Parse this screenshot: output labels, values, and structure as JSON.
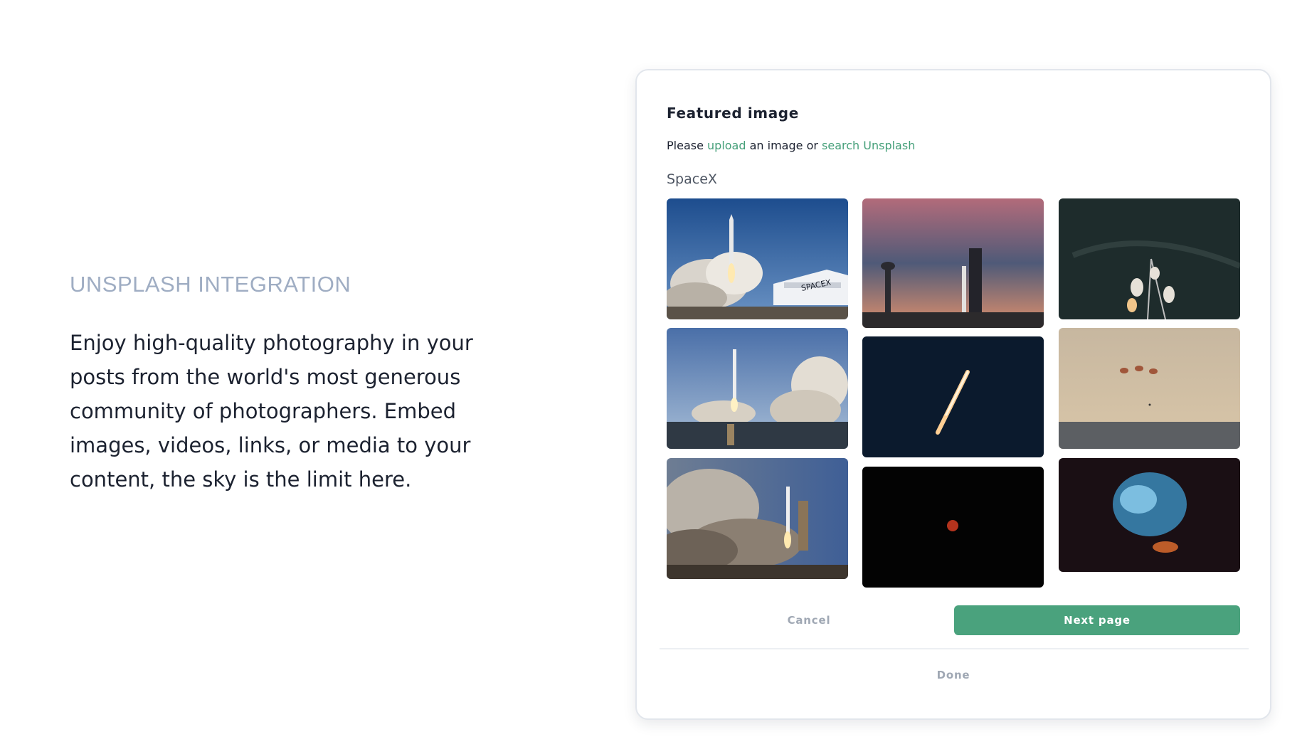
{
  "promo": {
    "eyebrow": "UNSPLASH INTEGRATION",
    "body": "Enjoy high-quality photography in your posts from the world's most generous community of photographers. Embed images, videos, links, or media to your content, the sky is the limit here."
  },
  "dialog": {
    "title": "Featured image",
    "subtitle_prefix": "Please",
    "upload_link": "upload",
    "subtitle_middle": "an image or",
    "search_link": "search Unsplash",
    "search_query": "SpaceX",
    "images": [
      {
        "id": 1,
        "subject": "falcon-heavy-launch-spacex-hangar"
      },
      {
        "id": 2,
        "subject": "launch-pad-sunset"
      },
      {
        "id": 3,
        "subject": "satellite-dish-tower-night"
      },
      {
        "id": 4,
        "subject": "rocket-launch-over-water"
      },
      {
        "id": 5,
        "subject": "rocket-in-dark-sky"
      },
      {
        "id": 6,
        "subject": "parachutes-over-ocean"
      },
      {
        "id": 7,
        "subject": "rocket-launch-smoke-clouds"
      },
      {
        "id": 8,
        "subject": "red-moon-black-sky"
      },
      {
        "id": 9,
        "subject": "blue-exhaust-plume"
      }
    ],
    "cancel_label": "Cancel",
    "next_label": "Next page",
    "done_label": "Done"
  },
  "colors": {
    "accent": "#4aa27d",
    "link": "#46a07a",
    "eyebrow": "#9fadc3",
    "text": "#1c2230",
    "muted": "#a0a8b4"
  }
}
